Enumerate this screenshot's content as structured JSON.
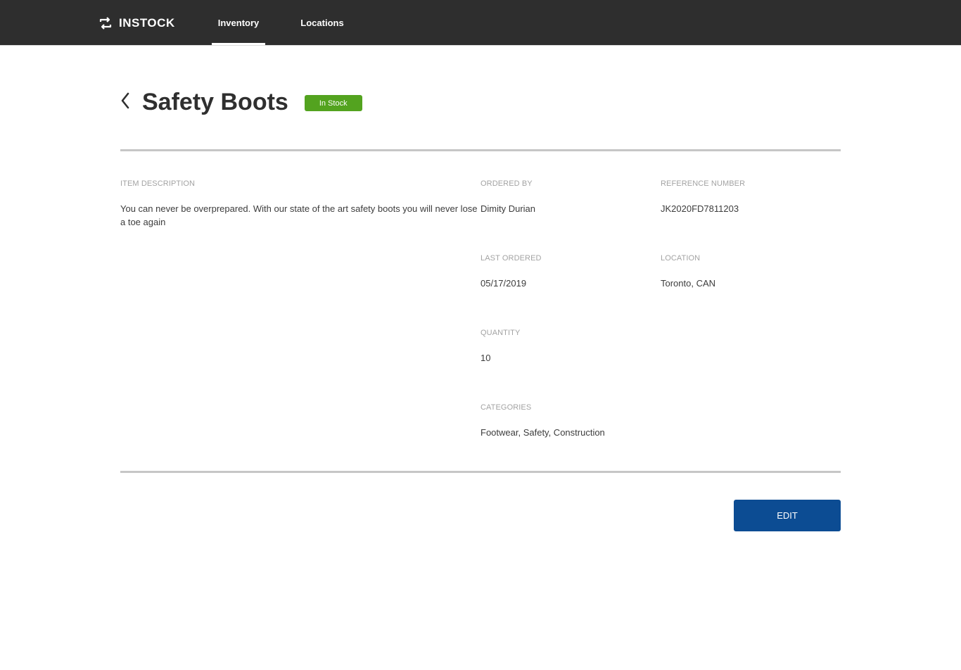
{
  "app": {
    "brand_name": "INSTOCK",
    "brand_icon": "swap-arrows-icon"
  },
  "nav": {
    "tabs": [
      {
        "label": "Inventory",
        "active": true
      },
      {
        "label": "Locations",
        "active": false
      }
    ]
  },
  "item": {
    "title": "Safety Boots",
    "status": "In Stock",
    "status_color": "#53a31f",
    "back_icon": "chevron-left-icon"
  },
  "fields": {
    "description": {
      "label": "ITEM DESCRIPTION",
      "value": "You can never be overprepared. With our state of the art safety boots you will never lose a toe again"
    },
    "ordered_by": {
      "label": "ORDERED BY",
      "value": "Dimity Durian"
    },
    "reference_number": {
      "label": "REFERENCE NUMBER",
      "value": "JK2020FD7811203"
    },
    "last_ordered": {
      "label": "LAST ORDERED",
      "value": "05/17/2019"
    },
    "location": {
      "label": "LOCATION",
      "value": "Toronto, CAN"
    },
    "quantity": {
      "label": "QUANTITY",
      "value": "10"
    },
    "categories": {
      "label": "CATEGORIES",
      "value": "Footwear, Safety, Construction"
    }
  },
  "actions": {
    "edit_label": "EDIT",
    "edit_color": "#0c4c93"
  },
  "colors": {
    "topbar": "#2e2e2e",
    "label_gray": "#a3a3a3",
    "text": "#3c3c3c"
  }
}
